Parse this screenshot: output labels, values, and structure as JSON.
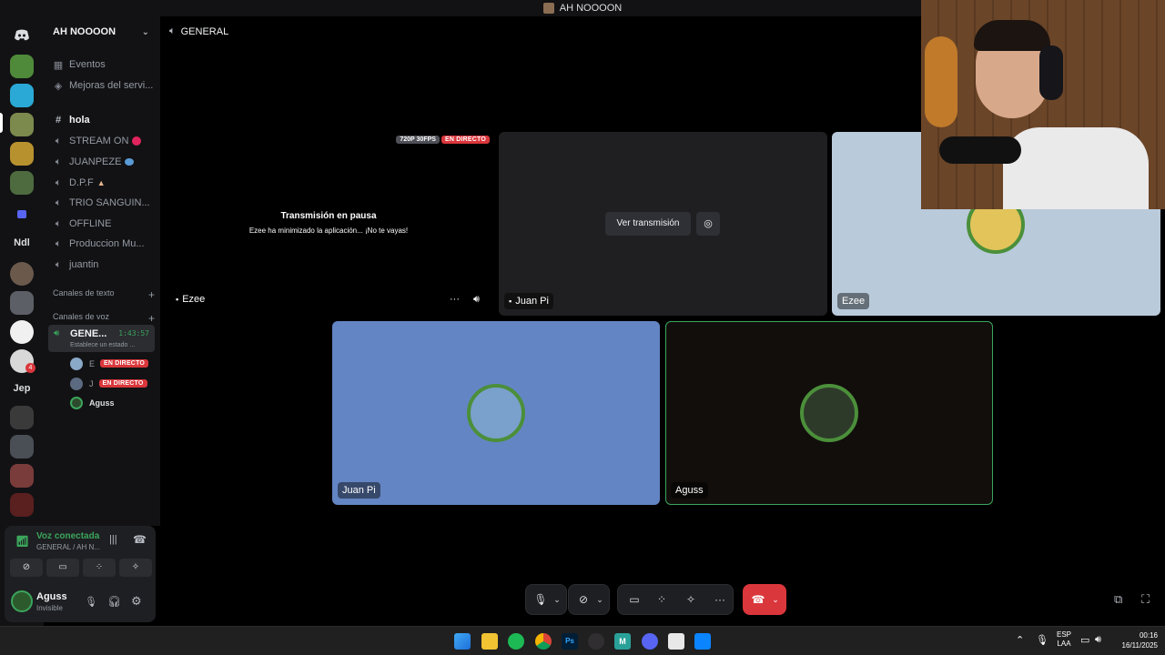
{
  "window": {
    "title": "AH NOOOON"
  },
  "server": {
    "name": "AH NOOOON",
    "rail_labels": {
      "ndl": "Ndl",
      "jep": "Jep",
      "badge": "4"
    }
  },
  "channels": {
    "top": [
      {
        "label": "Eventos"
      },
      {
        "label": "Mejoras del servi..."
      }
    ],
    "list": [
      {
        "label": "hola",
        "type": "text",
        "active": true
      },
      {
        "label": "STREAM ON",
        "type": "voice",
        "emoji": "🔴"
      },
      {
        "label": "JUANPEZE",
        "type": "voice",
        "emoji": "🔵"
      },
      {
        "label": "D.P.F",
        "type": "voice",
        "emoji": "🙏"
      },
      {
        "label": "TRIO SANGUIN...",
        "type": "voice"
      },
      {
        "label": "OFFLINE",
        "type": "voice"
      },
      {
        "label": "Produccion Mu...",
        "type": "voice"
      },
      {
        "label": "juantin",
        "type": "voice"
      }
    ],
    "categories": {
      "text": "Canales de texto",
      "voice": "Canales de voz"
    },
    "voice_channel": {
      "name": "GENE...",
      "timer": "1:43:57",
      "status": "Establece un estado ...",
      "members": [
        {
          "initial": "E",
          "badge": "EN DIRECTO"
        },
        {
          "initial": "J",
          "badge": "EN DIRECTO"
        },
        {
          "name": "Aguss"
        }
      ]
    }
  },
  "voice_panel": {
    "status": "Voz conectada",
    "location": "GENERAL / AH N..."
  },
  "user": {
    "name": "Aguss",
    "status": "Invisible"
  },
  "stage": {
    "header": "GENERAL",
    "tiles": {
      "ezee_stream": {
        "quality": "720P 30FPS",
        "live": "EN DIRECTO",
        "paused_title": "Transmisión en pausa",
        "paused_text": "Ezee ha minimizado la aplicación... ¡No te vayas!",
        "name": "Ezee"
      },
      "juan_stream": {
        "button": "Ver transmisión",
        "name": "Juan Pi"
      },
      "ezee_user": {
        "name": "Ezee"
      },
      "juan_user": {
        "name": "Juan Pi"
      },
      "aguss_user": {
        "name": "Aguss"
      }
    }
  },
  "taskbar": {
    "lang": "ESP",
    "lang2": "LAA",
    "time": "00:16",
    "date": "16/11/2025"
  },
  "colors": {
    "live_red": "#da373c",
    "juan_tile": "#6485c4",
    "ezee_tile": "#b9cadb",
    "speaking_green": "#3ba55c",
    "hangup": "#da373c"
  }
}
